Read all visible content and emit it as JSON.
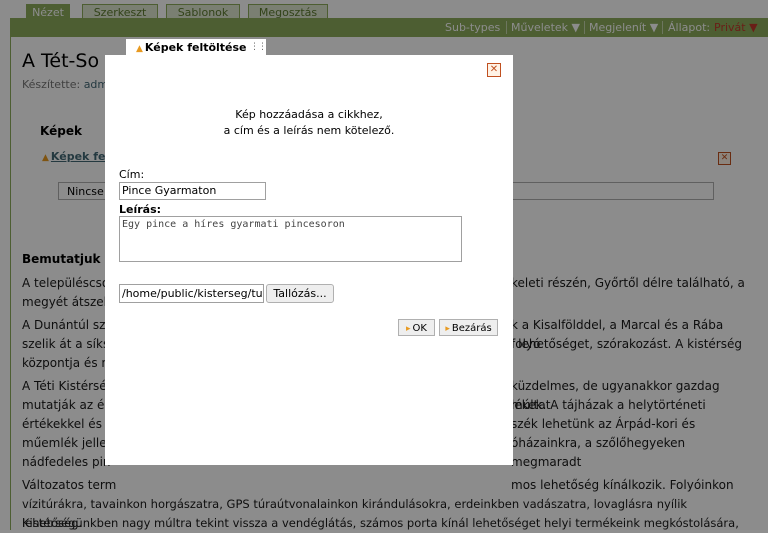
{
  "tabs": [
    {
      "label": "Nézet",
      "active": true
    },
    {
      "label": "Szerkeszt",
      "active": false
    },
    {
      "label": "Sablonok",
      "active": false
    },
    {
      "label": "Megosztás",
      "active": false
    }
  ],
  "actionbar": {
    "subtypes": "Sub-types",
    "muveletek": "Műveletek ▼",
    "megjelenit": "Megjelenít ▼",
    "allapot_label": "Állapot:",
    "allapot_value": "Privát ▼"
  },
  "article": {
    "title": "A Tét-So",
    "byline_prefix": "Készítette:",
    "byline_author": "adm",
    "section_images": "Képek",
    "upload_link": "Képek fe",
    "no_files": "Nincse",
    "subheading": "Bemutatjuk a",
    "paragraphs": [
      {
        "left": "A településcsop",
        "right": "keleti részén, Győrtől délre található, a"
      },
      {
        "left": "megyét átszelő",
        "right": ""
      },
      {
        "left": "A Dunántúl szá",
        "right": "k a Kisalfölddel, a Marcal és a Rába folyó"
      },
      {
        "left": "szelik át a síksa",
        "right": "i lehetőséget, szórakozást. A kistérség"
      },
      {
        "left": "központja és n",
        "right": ""
      },
      {
        "left": "A Téti Kistérség",
        "right": "küzdelmes, de ugyanakkor gazdag múltat"
      },
      {
        "left": "mutatják az ép",
        "right": "lékek. A tájházak a helytörténeti"
      },
      {
        "left": "értékekkel és t",
        "right": "szék lehetünk az Árpád-kori és"
      },
      {
        "left": "műemlék jelleg",
        "right": "óházainkra, a szőlőhegyeken megmaradt"
      },
      {
        "left": "nádfedeles pin",
        "right": ""
      },
      {
        "left": "Változatos term",
        "right": "mos lehetőség kínálkozik. Folyóinkon"
      },
      {
        "left": "vízitúrákra, tavainkon horgászatra, GPS túraútvonalainkon kirándulásokra, erdeinkben vadászatra, lovaglásra nyílik lehetőség.",
        "right": ""
      },
      {
        "left": "Kistérségünkben nagy múltra tekint vissza a vendéglátás, számos porta kínál lehetőséget helyi termékeink megkóstolására,",
        "right": ""
      }
    ]
  },
  "dialog": {
    "title": "Képek feltöltése",
    "intro_line1": "Kép hozzáadása a cikkhez,",
    "intro_line2": "a cím és a leírás nem kötelező.",
    "cim_label": "Cím:",
    "cim_value": "Pince Gyarmaton",
    "leiras_label": "Leírás:",
    "leiras_value": "Egy pince a híres gyarmati pincesoron",
    "file_value": "/home/public/kisterseg/turisz",
    "browse_label": "Tallózás...",
    "ok_label": "OK",
    "close_label": "Bezárás"
  },
  "colors": {
    "accent": "#8cac5c",
    "status_private": "#c0392b"
  }
}
